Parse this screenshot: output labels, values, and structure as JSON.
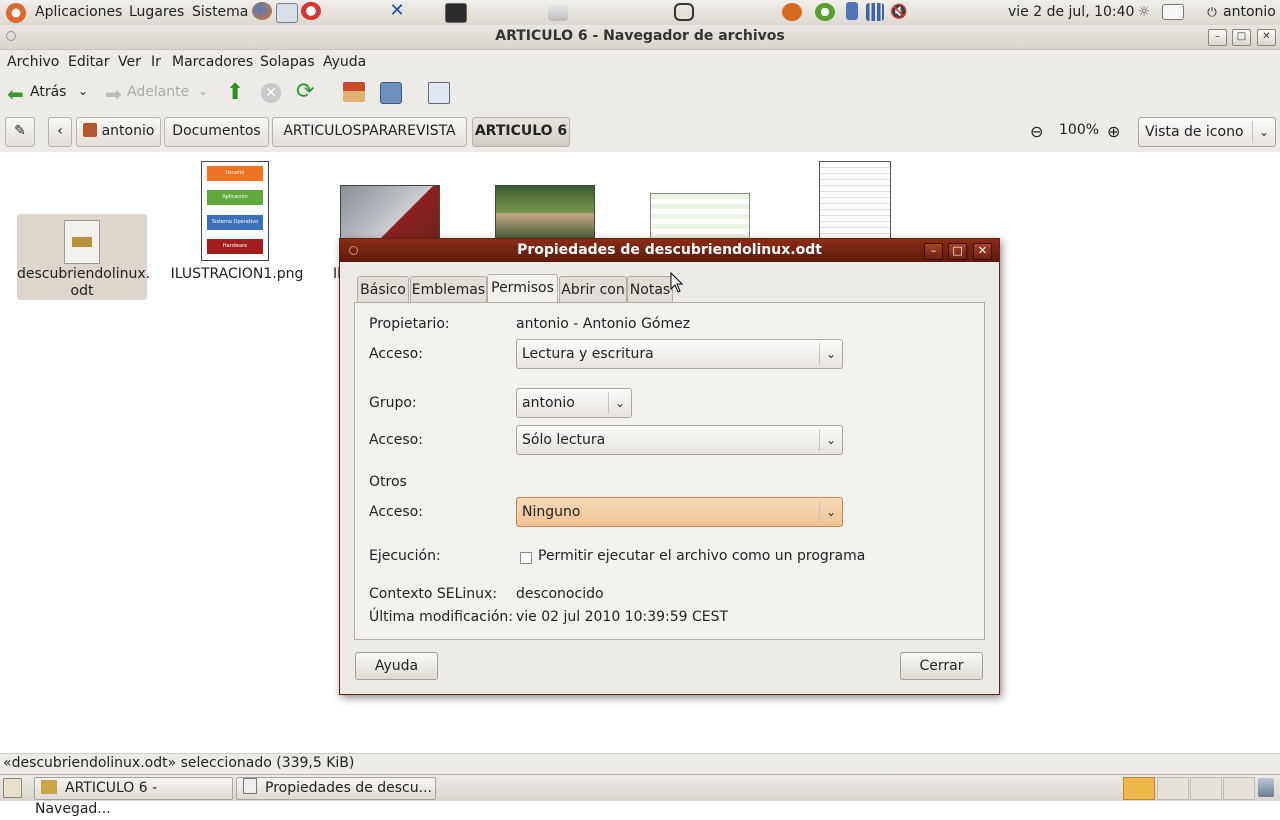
{
  "top_panel": {
    "menus": [
      "Aplicaciones",
      "Lugares",
      "Sistema"
    ],
    "clock": "vie  2 de jul, 10:40",
    "user": "antonio"
  },
  "window": {
    "title": "ARTICULO 6 - Navegador de archivos"
  },
  "menubar": [
    "Archivo",
    "Editar",
    "Ver",
    "Ir",
    "Marcadores",
    "Solapas",
    "Ayuda"
  ],
  "toolbar": {
    "back": "Atrás",
    "forward": "Adelante"
  },
  "location_bar": {
    "crumbs": [
      "antonio",
      "Documentos",
      "ARTICULOSPARAREVISTA",
      "ARTICULO 6"
    ],
    "zoom": "100%",
    "view_mode": "Vista de icono"
  },
  "files": [
    {
      "name_line1": "descubriendolinux.",
      "name_line2": "odt"
    },
    {
      "name_line1": "ILUSTRACION1.png"
    },
    {
      "name_line1": "Il"
    }
  ],
  "thumb_labels": [
    "Usuario",
    "Aplicación",
    "Sistema Operativo",
    "Hardware"
  ],
  "status_bar": "«descubriendolinux.odt» seleccionado (339,5 KiB)",
  "taskbar": {
    "tasks": [
      "ARTICULO 6 - Navegad...",
      "Propiedades de descu..."
    ]
  },
  "dialog": {
    "title": "Propiedades de descubriendolinux.odt",
    "tabs": [
      "Básico",
      "Emblemas",
      "Permisos",
      "Abrir con",
      "Notas"
    ],
    "active_tab": "Permisos",
    "owner_label": "Propietario:",
    "owner_value": "antonio - Antonio Gómez",
    "access_label": "Acceso:",
    "owner_access": "Lectura y escritura",
    "group_label": "Grupo:",
    "group_value": "antonio",
    "group_access": "Sólo lectura",
    "others_label": "Otros",
    "others_access": "Ninguno",
    "exec_label": "Ejecución:",
    "exec_checkbox": "Permitir ejecutar el archivo como un programa",
    "selinux_label": "Contexto SELinux:",
    "selinux_value": "desconocido",
    "modified_label": "Última modificación:",
    "modified_value": "vie 02 jul 2010 10:39:59 CEST",
    "help_button": "Ayuda",
    "close_button": "Cerrar"
  }
}
